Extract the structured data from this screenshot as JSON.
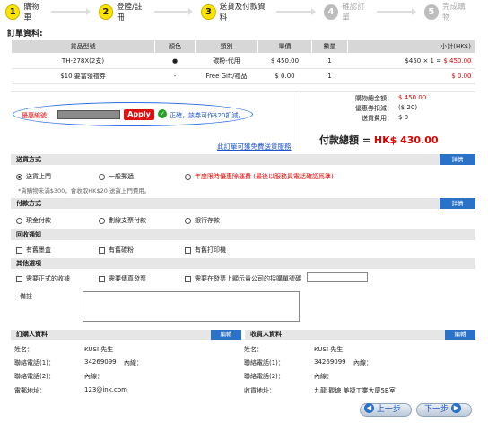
{
  "steps": [
    {
      "num": "1",
      "label": "購物車"
    },
    {
      "num": "2",
      "label": "登陸/註冊"
    },
    {
      "num": "3",
      "label": "送貨及付款資料"
    },
    {
      "num": "4",
      "label": "確認訂單"
    },
    {
      "num": "5",
      "label": "完成購物"
    }
  ],
  "order_title": "訂單資料:",
  "table": {
    "headers": [
      "貨品型號",
      "顏色",
      "類別",
      "單價",
      "數量",
      "小計(HK$)"
    ],
    "rows": [
      {
        "model": "TH-278X(2支)",
        "color": "●",
        "type": "碳粉-代用",
        "price": "$ 450.00",
        "qty": "1",
        "subtotal_calc": "$450 × 1 = ",
        "subtotal": "$ 450.00"
      },
      {
        "model": "$10 要當領禮券",
        "color": "-",
        "type": "Free Gift/禮品",
        "price": "$ 0.00",
        "qty": "1",
        "subtotal_calc": "",
        "subtotal": "$ 0.00"
      }
    ]
  },
  "discount": {
    "label": "優惠編號：",
    "apply": "Apply",
    "ok_icon": "check-circle-icon",
    "message": "正確，該券可作$20扣減。",
    "free_shipping_link": "此訂單可獲免費送貨服務"
  },
  "totals": {
    "goods_label": "購物總金額：",
    "goods_value": "$ 450.00",
    "coupon_label": "優惠券扣減：",
    "coupon_value": "($ 20)",
    "shipping_label": "送貨費用：",
    "shipping_value": "$ 0",
    "grand_label": "付款總額 = ",
    "grand_value": "HK$ 430.00"
  },
  "delivery": {
    "title": "送貨方式",
    "detail_btn": "詳情",
    "options": [
      "送貨上門",
      "一般郵遞",
      "年度限時優惠除運費 (最後以服務員電話確認爲準)"
    ],
    "note": "*貨購物未滿$300，會收取HK$20 送貨上門費用。"
  },
  "payment": {
    "title": "付款方式",
    "detail_btn": "詳情",
    "options": [
      "現金付款",
      "劃線支票付款",
      "銀行存款"
    ]
  },
  "recycle": {
    "title": "回收通知",
    "options": [
      "有舊墨盒",
      "有舊碳粉",
      "有舊打印機"
    ]
  },
  "other": {
    "title": "其他選項",
    "options": [
      "需要正式的收據",
      "需要傳真發票",
      "需要在發票上顯示貴公司的採購單號碼"
    ],
    "remarks_label": "備註"
  },
  "buyer": {
    "title": "訂購人資料",
    "edit": "編輯",
    "name_label": "姓名：",
    "name": "KUSI  先生",
    "phone1_label": "聯絡電話(1)：",
    "phone1": "34269099",
    "ext1_label": "內線：",
    "phone2_label": "聯絡電話(2)：",
    "ext2_label": "內線：",
    "email_label": "電郵地址：",
    "email": "123@ink.com"
  },
  "receiver": {
    "title": "收貨人資料",
    "edit": "編輯",
    "name_label": "姓名：",
    "name": "KUSI  先生",
    "phone1_label": "聯絡電話(1)：",
    "phone1": "34269099",
    "ext1_label": "內線：",
    "phone2_label": "聯絡電話(2)：",
    "ext2_label": "內線：",
    "address_label": "收貨地址：",
    "address": "九龍 觀塘 美捷工業大廈5B室"
  },
  "nav": {
    "prev": "上一步",
    "next": "下一步"
  }
}
